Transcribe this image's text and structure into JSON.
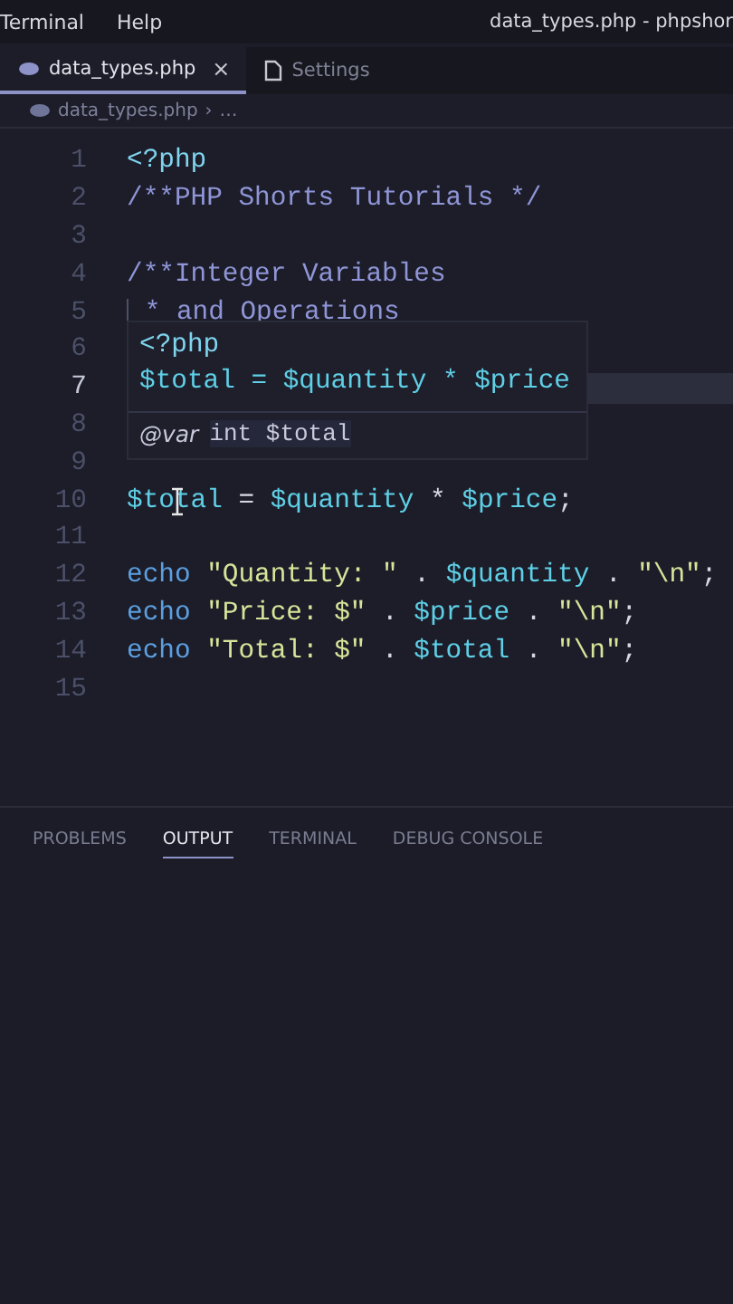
{
  "menu_bar": {
    "items": [
      "Terminal",
      "Help"
    ],
    "window_title": "data_types.php - phpshor"
  },
  "tabs": [
    {
      "label": "data_types.php",
      "kind": "php",
      "selected": true,
      "close": "×"
    },
    {
      "label": "Settings",
      "kind": "file",
      "selected": false
    }
  ],
  "breadcrumb": {
    "file": "data_types.php",
    "separator": "›",
    "rest": "…"
  },
  "code_lines": [
    {
      "number": "1",
      "selected": false,
      "tokens": [
        {
          "kind": "tag",
          "text": "<?php"
        }
      ]
    },
    {
      "number": "2",
      "selected": false,
      "tokens": [
        {
          "kind": "comment",
          "text": "/**PHP Shorts Tutorials */"
        }
      ]
    },
    {
      "number": "3",
      "selected": false
    },
    {
      "number": "4",
      "selected": false,
      "tokens": [
        {
          "kind": "comment",
          "text": "/**Integer Variables"
        }
      ]
    },
    {
      "number": "5",
      "selected": false,
      "guide": true,
      "tokens": [
        {
          "kind": "comment",
          "text": " * and Operations"
        }
      ]
    },
    {
      "number": "6",
      "selected": false
    },
    {
      "number": "7",
      "selected": true
    },
    {
      "number": "8",
      "selected": false
    },
    {
      "number": "9",
      "selected": false
    },
    {
      "number": "10",
      "selected": false,
      "cursor": true,
      "tokens": [
        {
          "kind": "variable",
          "text": "$total"
        },
        {
          "kind": "operator",
          "text": " = "
        },
        {
          "kind": "variable",
          "text": "$quantity"
        },
        {
          "kind": "operator",
          "text": " * "
        },
        {
          "kind": "variable",
          "text": "$price"
        },
        {
          "kind": "operator",
          "text": ";"
        }
      ]
    },
    {
      "number": "11",
      "selected": false
    },
    {
      "number": "12",
      "selected": false,
      "tokens": [
        {
          "kind": "keyword",
          "text": "echo "
        },
        {
          "kind": "string",
          "text": "\"Quantity: \""
        },
        {
          "kind": "operator",
          "text": " . "
        },
        {
          "kind": "variable",
          "text": "$quantity"
        },
        {
          "kind": "operator",
          "text": " . "
        },
        {
          "kind": "string",
          "text": "\"\\n\""
        },
        {
          "kind": "operator",
          "text": ";"
        }
      ]
    },
    {
      "number": "13",
      "selected": false,
      "tokens": [
        {
          "kind": "keyword",
          "text": "echo "
        },
        {
          "kind": "string",
          "text": "\"Price: $\""
        },
        {
          "kind": "operator",
          "text": " . "
        },
        {
          "kind": "variable",
          "text": "$price"
        },
        {
          "kind": "operator",
          "text": " . "
        },
        {
          "kind": "string",
          "text": "\"\\n\""
        },
        {
          "kind": "operator",
          "text": ";"
        }
      ]
    },
    {
      "number": "14",
      "selected": false,
      "tokens": [
        {
          "kind": "keyword",
          "text": "echo "
        },
        {
          "kind": "string",
          "text": "\"Total: $\""
        },
        {
          "kind": "operator",
          "text": " . "
        },
        {
          "kind": "variable",
          "text": "$total"
        },
        {
          "kind": "operator",
          "text": " . "
        },
        {
          "kind": "string",
          "text": "\"\\n\""
        },
        {
          "kind": "operator",
          "text": ";"
        }
      ]
    },
    {
      "number": "15",
      "selected": false
    }
  ],
  "hover_popup": {
    "code": [
      "<?php",
      "$total = $quantity * $price"
    ],
    "doc_tag": "@var",
    "doc_text": "int $total"
  },
  "panel_tabs": [
    {
      "label": "PROBLEMS",
      "selected": false
    },
    {
      "label": "OUTPUT",
      "selected": true
    },
    {
      "label": "TERMINAL",
      "selected": false
    },
    {
      "label": "DEBUG CONSOLE",
      "selected": false
    }
  ]
}
